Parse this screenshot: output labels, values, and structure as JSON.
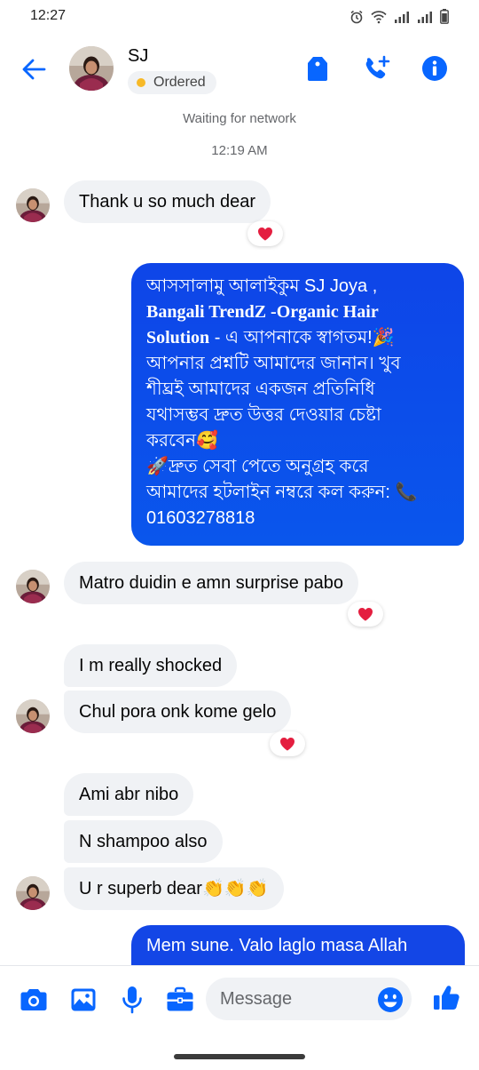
{
  "status_bar": {
    "time": "12:27"
  },
  "contact": {
    "name": "SJ",
    "status": "Ordered"
  },
  "conversation": {
    "network_notice": "Waiting for network",
    "timestamp": "12:19 AM"
  },
  "messages": {
    "m1": "Thank u so much dear",
    "greeting": {
      "line1": "আসসালামু আলাইকুম SJ Joya  ,",
      "line2": "Bangali TrendZ -Organic Hair",
      "line3_bold": "Solution",
      "line3_rest": " - এ আপনাকে স্বাগতম!🎉",
      "line4": "আপনার প্রশ্নটি আমাদের জানান। খুব",
      "line5": "শীঘ্রই আমাদের একজন প্রতিনিধি",
      "line6": "যথাসম্ভব দ্রুত উত্তর দেওয়ার চেষ্টা",
      "line7": "করবেন🥰",
      "line8": "🚀দ্রুত সেবা পেতে অনুগ্রহ করে",
      "line9": "আমাদের হটলাইন নম্বরে কল করুন: 📞",
      "line10": "01603278818"
    },
    "m2": "Matro duidin e amn surprise pabo",
    "m3": "I m really shocked",
    "m4": "Chul pora onk kome gelo",
    "m5": "Ami abr nibo",
    "m6": "N shampoo also",
    "m7": "U r superb dear",
    "m7_emoji": "👏👏👏",
    "m8": "Mem sune. Valo laglo masa Allah"
  },
  "composer": {
    "placeholder": "Message"
  },
  "colors": {
    "accent": "#0866ff",
    "outgoing_bubble": "#0a55ea",
    "incoming_bubble": "#f0f2f5",
    "status_dot": "#f7b928",
    "heart": "#e41e3f"
  },
  "icons": {
    "back": "arrow-left-icon",
    "header": [
      "tag-icon",
      "add-call-icon",
      "info-icon"
    ],
    "composer": [
      "camera-icon",
      "image-icon",
      "microphone-icon",
      "briefcase-icon",
      "emoji-icon",
      "thumbs-up-icon"
    ],
    "reaction": "heart-icon"
  }
}
